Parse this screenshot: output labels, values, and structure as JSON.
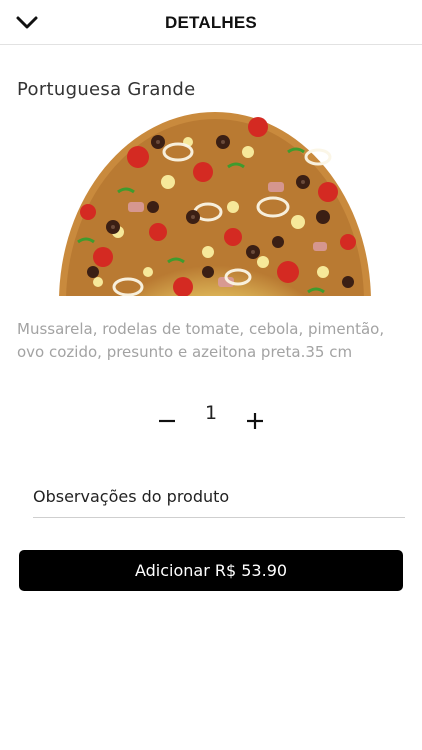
{
  "header": {
    "title": "DETALHES",
    "back_icon": "chevron-down-icon"
  },
  "product": {
    "name": "Portuguesa Grande",
    "image": "pizza-portuguesa-photo",
    "description": "Mussarela, rodelas de tomate, cebola, pimentão, ovo cozido, presunto e azeitona preta.35 cm"
  },
  "quantity": {
    "value": "1",
    "minus_icon": "minus-icon",
    "plus_icon": "plus-icon"
  },
  "observations": {
    "placeholder": "Observações do produto",
    "value": ""
  },
  "add_button": {
    "label": "Adicionar R$ 53.90"
  },
  "colors": {
    "button_bg": "#000000",
    "button_text": "#ffffff",
    "description_text": "#a3a3a3",
    "divider": "#e2e2e2"
  }
}
